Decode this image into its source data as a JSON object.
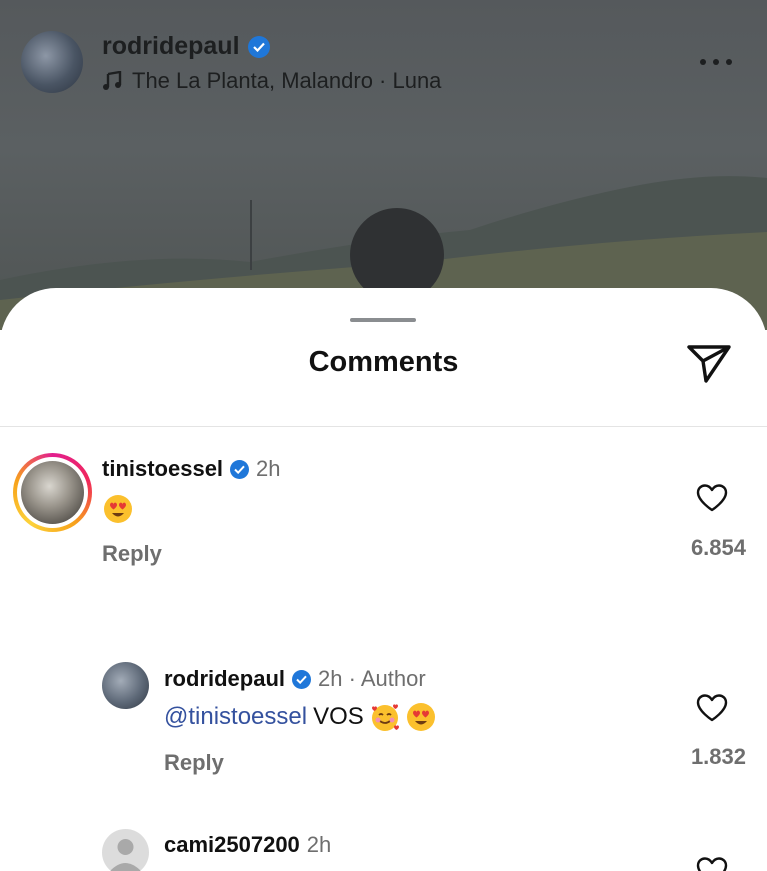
{
  "post": {
    "username": "rodridepaul",
    "audio": "The La Planta, Malandro · Luna",
    "verified": true
  },
  "sheet": {
    "title": "Comments"
  },
  "comments": [
    {
      "username": "tinistoessel",
      "verified": true,
      "time": "2h",
      "text_emoji": "heart-eyes",
      "reply_label": "Reply",
      "likes": "6.854",
      "has_story_ring": true
    },
    {
      "username": "rodridepaul",
      "verified": true,
      "time": "2h",
      "author_tag": "Author",
      "meta": "2h · Author",
      "mention": "@tinistoessel",
      "text": "VOS",
      "emojis": [
        "smiling-hearts",
        "heart-eyes"
      ],
      "reply_label": "Reply",
      "likes": "1.832"
    },
    {
      "username": "cami2507200",
      "time": "2h"
    }
  ],
  "colors": {
    "verified": "#1f77d9",
    "mention": "#34519e",
    "secondary_text": "#6e6e6e",
    "dim_overlay": "#55595c"
  }
}
